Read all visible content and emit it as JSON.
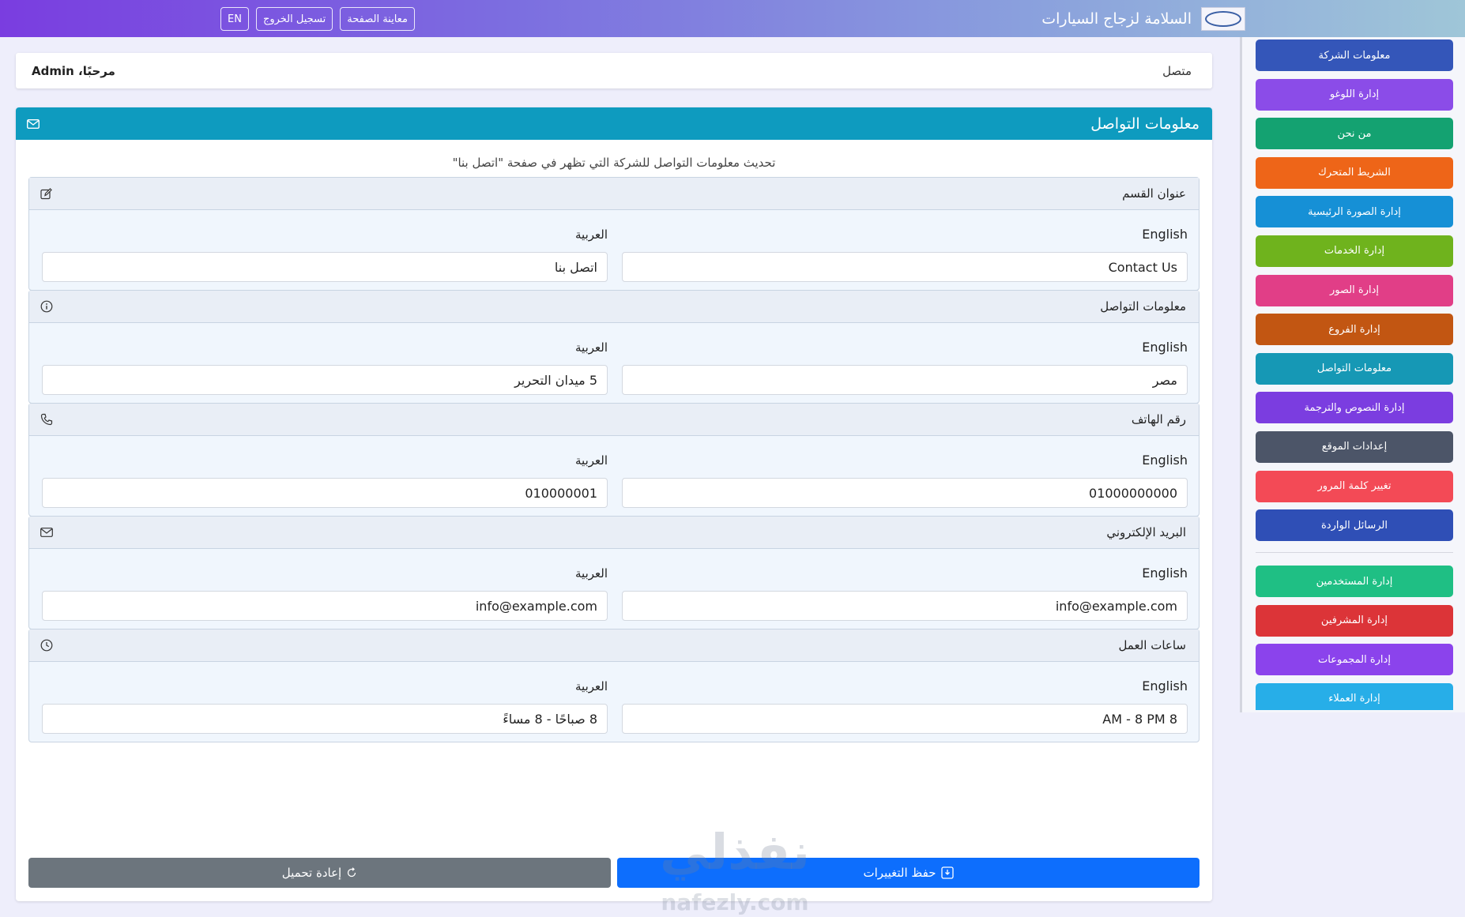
{
  "topbar": {
    "brand_title": "السلامة لزجاج السيارات",
    "buttons": {
      "preview": "معاينة الصفحة",
      "logout": "تسجيل الخروج",
      "lang": "EN"
    }
  },
  "sidebar": {
    "items": [
      {
        "label": "معلومات الشركة",
        "color": "#3456b9"
      },
      {
        "label": "إدارة اللوغو",
        "color": "#8b4ce8"
      },
      {
        "label": "من نحن",
        "color": "#14a271"
      },
      {
        "label": "الشريط المتحرك",
        "color": "#ee6518"
      },
      {
        "label": "إدارة الصورة الرئيسية",
        "color": "#1690d6"
      },
      {
        "label": "إدارة الخدمات",
        "color": "#6fb31d"
      },
      {
        "label": "إدارة الصور",
        "color": "#e13e87"
      },
      {
        "label": "إدارة الفروع",
        "color": "#c25612"
      },
      {
        "label": "معلومات التواصل",
        "color": "#1698b5"
      },
      {
        "label": "إدارة النصوص والترجمة",
        "color": "#7b3de0"
      },
      {
        "label": "إعدادات الموقع",
        "color": "#4c5568"
      },
      {
        "label": "تغيير كلمة المرور",
        "color": "#f34a56"
      },
      {
        "label": "الرسائل الواردة",
        "color": "#2f4fb6"
      }
    ],
    "admin_items": [
      {
        "label": "إدارة المستخدمين",
        "color": "#1fbf84"
      },
      {
        "label": "إدارة المشرفين",
        "color": "#dc3438"
      },
      {
        "label": "إدارة المجموعات",
        "color": "#8b43ec"
      },
      {
        "label": "إدارة العملاء",
        "color": "#27aee8"
      }
    ]
  },
  "welcome": {
    "status": "متصل",
    "greeting": "مرحبًا، Admin"
  },
  "card": {
    "title": "معلومات التواصل",
    "subtitle": "تحديث معلومات التواصل للشركة التي تظهر في صفحة \"اتصل بنا\"",
    "sections": [
      {
        "title": "عنوان القسم",
        "icon": "edit-icon",
        "en_label": "English",
        "ar_label": "العربية",
        "en_value": "Contact Us",
        "ar_value": "اتصل بنا"
      },
      {
        "title": "معلومات التواصل",
        "icon": "info-icon",
        "en_label": "English",
        "ar_label": "العربية",
        "en_value": "مصر",
        "ar_value": "5 ميدان التحرير"
      },
      {
        "title": "رقم الهاتف",
        "icon": "phone-icon",
        "en_label": "English",
        "ar_label": "العربية",
        "en_value": "01000000000",
        "ar_value": "010000001"
      },
      {
        "title": "البريد الإلكتروني",
        "icon": "mail-icon",
        "en_label": "English",
        "ar_label": "العربية",
        "en_value": "info@example.com",
        "ar_value": "info@example.com"
      },
      {
        "title": "ساعات العمل",
        "icon": "clock-icon",
        "en_label": "English",
        "ar_label": "العربية",
        "en_value": "8 AM - 8 PM",
        "ar_value": "8 صباحًا - 8 مساءً"
      }
    ],
    "save_label": "حفظ التغييرات",
    "reload_label": "إعادة تحميل"
  },
  "watermark": {
    "big": "نفذلي",
    "small": "nafezly.com"
  }
}
